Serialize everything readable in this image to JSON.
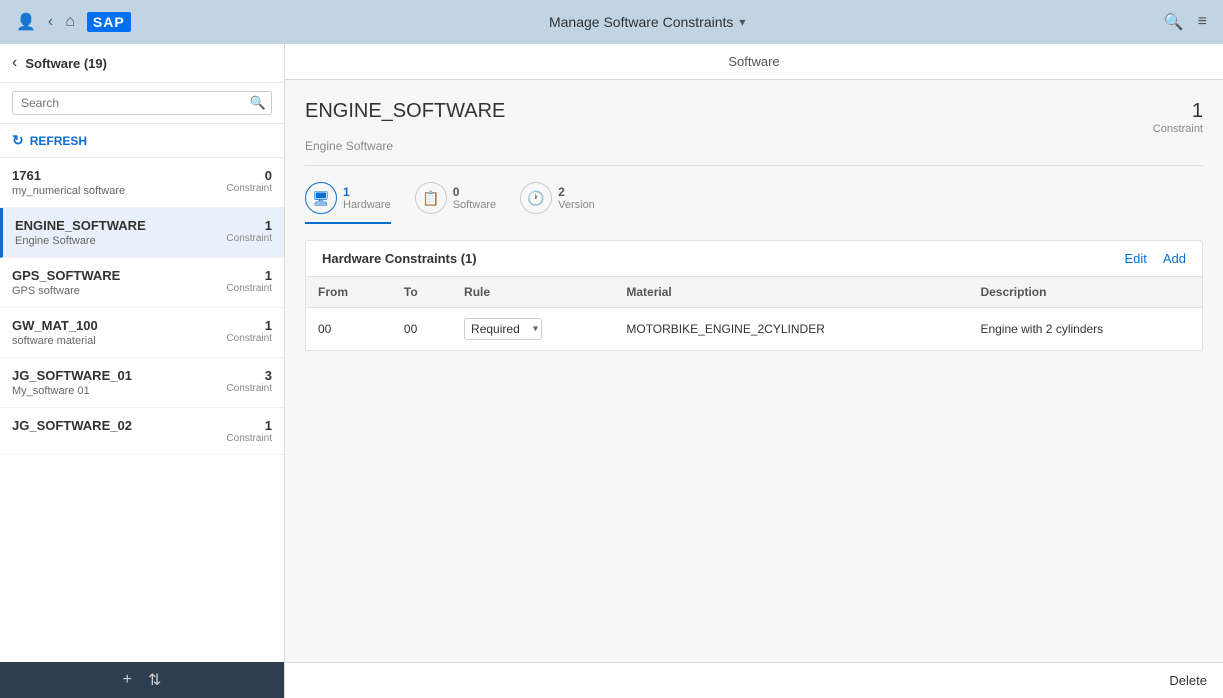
{
  "app": {
    "title": "Manage Software Constraints",
    "title_chevron": "▾"
  },
  "topbar": {
    "user_icon": "👤",
    "back_icon": "‹",
    "home_icon": "⌂",
    "search_icon": "🔍",
    "list_icon": "≡"
  },
  "sidebar": {
    "back_label": "‹",
    "title": "Software (19)",
    "search_placeholder": "Search",
    "refresh_label": "REFRESH",
    "items": [
      {
        "name": "1761",
        "sub": "my_numerical software",
        "count": "0",
        "constraint_label": "Constraint",
        "active": false
      },
      {
        "name": "ENGINE_SOFTWARE",
        "sub": "Engine Software",
        "count": "1",
        "constraint_label": "Constraint",
        "active": true
      },
      {
        "name": "GPS_SOFTWARE",
        "sub": "GPS software",
        "count": "1",
        "constraint_label": "Constraint",
        "active": false
      },
      {
        "name": "GW_MAT_100",
        "sub": "software material",
        "count": "1",
        "constraint_label": "Constraint",
        "active": false
      },
      {
        "name": "JG_SOFTWARE_01",
        "sub": "My_software 01",
        "count": "3",
        "constraint_label": "Constraint",
        "active": false
      },
      {
        "name": "JG_SOFTWARE_02",
        "sub": "",
        "count": "1",
        "constraint_label": "Constraint",
        "active": false
      }
    ],
    "footer": {
      "add_icon": "+",
      "sort_icon": "⇅"
    }
  },
  "main": {
    "header_label": "Software",
    "detail": {
      "title": "ENGINE_SOFTWARE",
      "subtitle": "Engine Software",
      "constraint_count": "1",
      "constraint_label": "Constraint"
    },
    "tabs": [
      {
        "id": "hardware",
        "icon": "🖥",
        "count": "1",
        "label": "Hardware",
        "active": true
      },
      {
        "id": "software",
        "icon": "📋",
        "count": "0",
        "label": "Software",
        "active": false
      },
      {
        "id": "version",
        "icon": "🕐",
        "count": "2",
        "label": "Version",
        "active": false
      }
    ],
    "table": {
      "section_title": "Hardware Constraints (1)",
      "edit_label": "Edit",
      "add_label": "Add",
      "columns": [
        "From",
        "To",
        "Rule",
        "Material",
        "Description"
      ],
      "rows": [
        {
          "from": "00",
          "to": "00",
          "rule": "Required",
          "material": "MOTORBIKE_ENGINE_2CYLINDER",
          "description": "Engine with 2 cylinders"
        }
      ]
    },
    "footer": {
      "delete_label": "Delete"
    }
  }
}
